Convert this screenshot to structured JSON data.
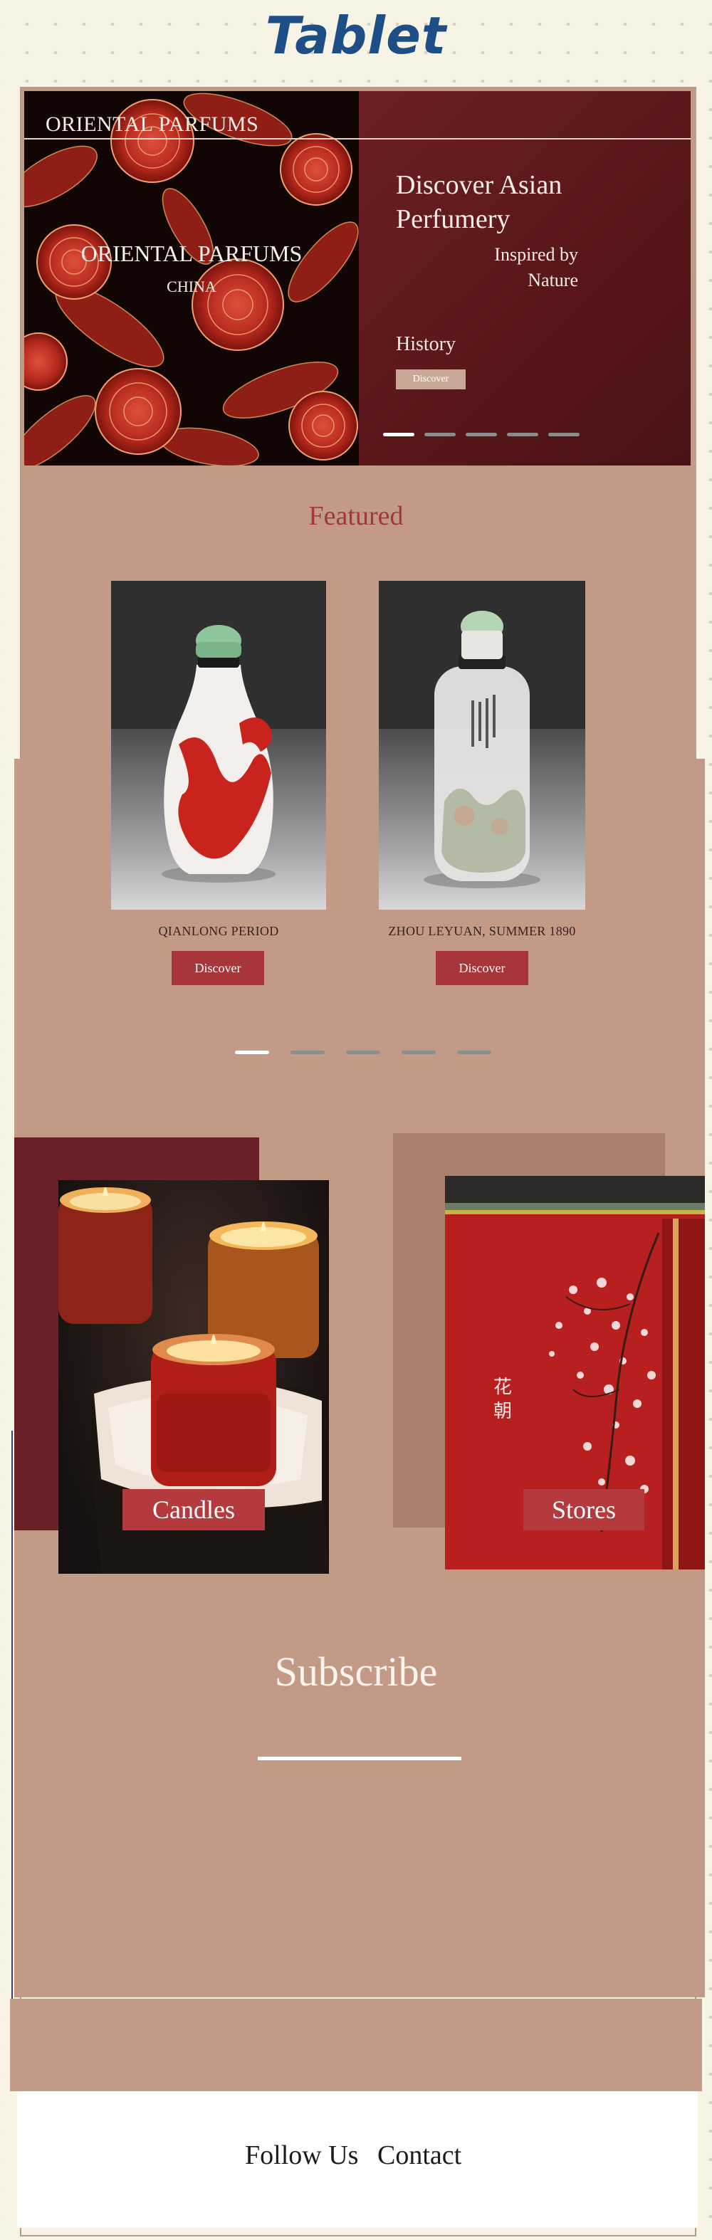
{
  "page": {
    "label": "Tablet"
  },
  "hero": {
    "brand_top": "ORIENTAL PARFUMS",
    "brand_center": "ORIENTAL PARFUMS",
    "brand_sub": "CHINA",
    "headline": "Discover Asian Perfumery",
    "tagline": "Inspired by Nature",
    "section_label": "History",
    "button_label": "Discover",
    "slides": 5,
    "active_slide": 1
  },
  "featured": {
    "title": "Featured",
    "items": [
      {
        "name": "QIANLONG PERIOD",
        "button": "Discover"
      },
      {
        "name": "ZHOU LEYUAN, SUMMER 1890",
        "button": "Discover"
      }
    ],
    "slides": 5,
    "active_slide": 1
  },
  "categories": [
    {
      "label": "Candles"
    },
    {
      "label": "Stores",
      "image_text": "花朝"
    }
  ],
  "subscribe": {
    "title": "Subscribe"
  },
  "footer": {
    "links": [
      "Follow Us",
      "Contact"
    ]
  },
  "colors": {
    "background": "#f7f4e6",
    "panel": "#c29a86",
    "maroon": "#6b2028",
    "accent": "#a8353a",
    "title_blue": "#1d4f86"
  }
}
